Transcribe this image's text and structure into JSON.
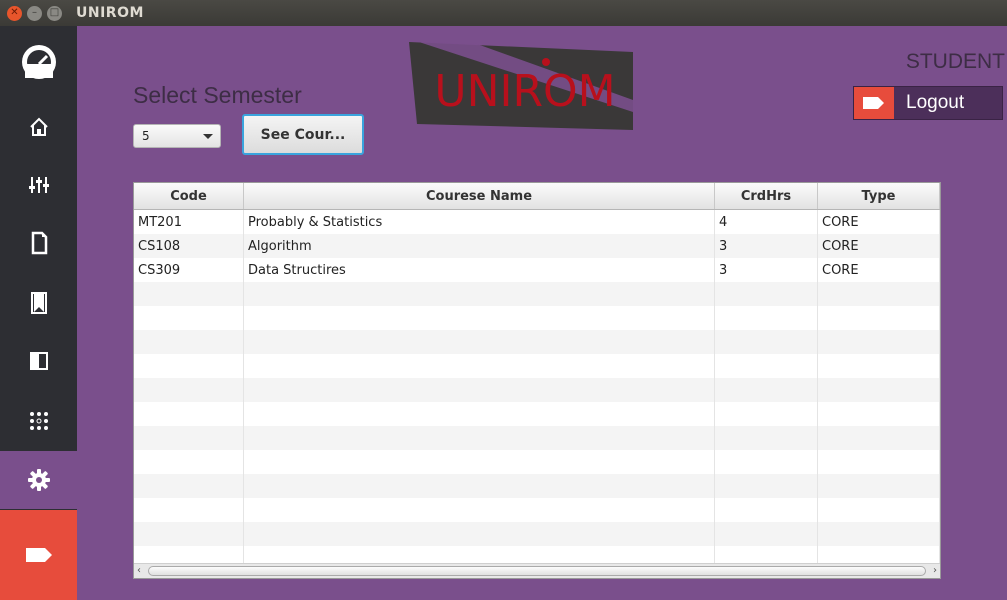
{
  "window": {
    "title": "UNIROM"
  },
  "sidebar": {
    "items": [
      {
        "icon": "gauge-icon"
      },
      {
        "icon": "home-icon"
      },
      {
        "icon": "sliders-icon"
      },
      {
        "icon": "document-icon"
      },
      {
        "icon": "bookmark-icon"
      },
      {
        "icon": "panel-icon"
      },
      {
        "icon": "dots-grid-icon"
      },
      {
        "icon": "gear-icon"
      },
      {
        "icon": "logout-tag-icon"
      }
    ]
  },
  "header": {
    "logo_text": "UNIROM",
    "role": "STUDENT",
    "logout_label": "Logout"
  },
  "semester": {
    "label": "Select Semester",
    "selected": "5",
    "button_label": "See Cour..."
  },
  "colors": {
    "accent": "#7a4f8c",
    "sidebar": "#2d2e33",
    "danger": "#e74c3c",
    "logo": "#c0111f"
  },
  "table": {
    "columns": [
      "Code",
      "Courese Name",
      "CrdHrs",
      "Type"
    ],
    "rows": [
      [
        "MT201",
        "Probably & Statistics",
        "4",
        "CORE"
      ],
      [
        "CS108",
        "Algorithm",
        "3",
        "CORE"
      ],
      [
        "CS309",
        "Data Structires",
        "3",
        "CORE"
      ],
      [
        "",
        "",
        "",
        ""
      ],
      [
        "",
        "",
        "",
        ""
      ],
      [
        "",
        "",
        "",
        ""
      ],
      [
        "",
        "",
        "",
        ""
      ],
      [
        "",
        "",
        "",
        ""
      ],
      [
        "",
        "",
        "",
        ""
      ],
      [
        "",
        "",
        "",
        ""
      ],
      [
        "",
        "",
        "",
        ""
      ],
      [
        "",
        "",
        "",
        ""
      ],
      [
        "",
        "",
        "",
        ""
      ],
      [
        "",
        "",
        "",
        ""
      ],
      [
        "",
        "",
        "",
        ""
      ]
    ]
  }
}
